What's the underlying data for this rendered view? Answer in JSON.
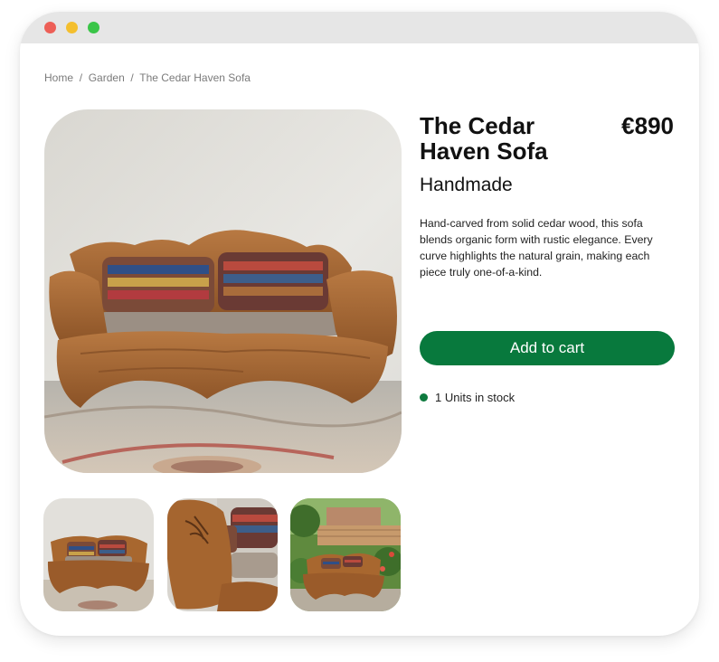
{
  "window": {
    "controls": [
      "close",
      "minimize",
      "maximize"
    ]
  },
  "breadcrumb": {
    "items": [
      "Home",
      "Garden",
      "The Cedar Haven Sofa"
    ],
    "separator": "/"
  },
  "product": {
    "title": "The Cedar Haven Sofa",
    "price": "€890",
    "subtitle": "Handmade",
    "description": "Hand-carved from solid cedar wood, this sofa blends organic form with rustic elegance. Every curve highlights the natural grain, making each piece truly one-of-a-kind.",
    "add_to_cart_label": "Add to cart",
    "stock_text": "1 Units in stock"
  },
  "gallery": {
    "thumbnails": [
      "front-view",
      "detail-view",
      "garden-view"
    ]
  },
  "colors": {
    "accent": "#08793d",
    "stock_dot": "#0e7a3e",
    "wood": "#a5652f",
    "wall": "#e3e2dd"
  }
}
